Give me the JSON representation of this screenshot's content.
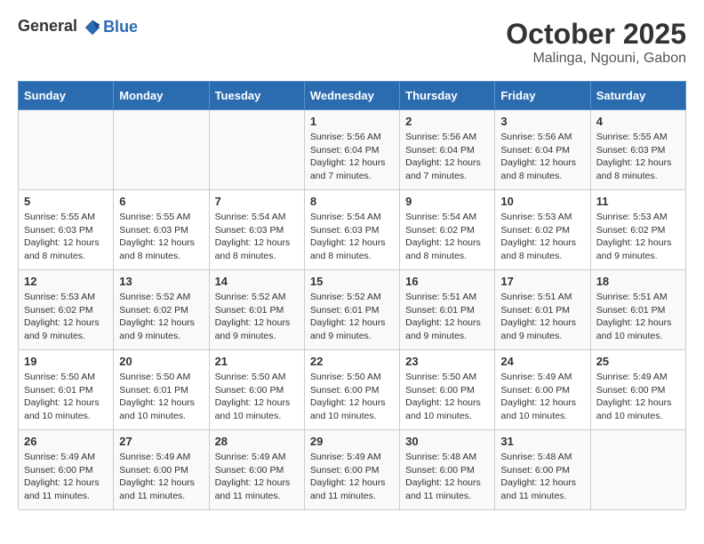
{
  "header": {
    "logo_line1": "General",
    "logo_line2": "Blue",
    "month": "October 2025",
    "location": "Malinga, Ngouni, Gabon"
  },
  "weekdays": [
    "Sunday",
    "Monday",
    "Tuesday",
    "Wednesday",
    "Thursday",
    "Friday",
    "Saturday"
  ],
  "weeks": [
    [
      {
        "day": "",
        "content": ""
      },
      {
        "day": "",
        "content": ""
      },
      {
        "day": "",
        "content": ""
      },
      {
        "day": "1",
        "content": "Sunrise: 5:56 AM\nSunset: 6:04 PM\nDaylight: 12 hours and 7 minutes."
      },
      {
        "day": "2",
        "content": "Sunrise: 5:56 AM\nSunset: 6:04 PM\nDaylight: 12 hours and 7 minutes."
      },
      {
        "day": "3",
        "content": "Sunrise: 5:56 AM\nSunset: 6:04 PM\nDaylight: 12 hours and 8 minutes."
      },
      {
        "day": "4",
        "content": "Sunrise: 5:55 AM\nSunset: 6:03 PM\nDaylight: 12 hours and 8 minutes."
      }
    ],
    [
      {
        "day": "5",
        "content": "Sunrise: 5:55 AM\nSunset: 6:03 PM\nDaylight: 12 hours and 8 minutes."
      },
      {
        "day": "6",
        "content": "Sunrise: 5:55 AM\nSunset: 6:03 PM\nDaylight: 12 hours and 8 minutes."
      },
      {
        "day": "7",
        "content": "Sunrise: 5:54 AM\nSunset: 6:03 PM\nDaylight: 12 hours and 8 minutes."
      },
      {
        "day": "8",
        "content": "Sunrise: 5:54 AM\nSunset: 6:03 PM\nDaylight: 12 hours and 8 minutes."
      },
      {
        "day": "9",
        "content": "Sunrise: 5:54 AM\nSunset: 6:02 PM\nDaylight: 12 hours and 8 minutes."
      },
      {
        "day": "10",
        "content": "Sunrise: 5:53 AM\nSunset: 6:02 PM\nDaylight: 12 hours and 8 minutes."
      },
      {
        "day": "11",
        "content": "Sunrise: 5:53 AM\nSunset: 6:02 PM\nDaylight: 12 hours and 9 minutes."
      }
    ],
    [
      {
        "day": "12",
        "content": "Sunrise: 5:53 AM\nSunset: 6:02 PM\nDaylight: 12 hours and 9 minutes."
      },
      {
        "day": "13",
        "content": "Sunrise: 5:52 AM\nSunset: 6:02 PM\nDaylight: 12 hours and 9 minutes."
      },
      {
        "day": "14",
        "content": "Sunrise: 5:52 AM\nSunset: 6:01 PM\nDaylight: 12 hours and 9 minutes."
      },
      {
        "day": "15",
        "content": "Sunrise: 5:52 AM\nSunset: 6:01 PM\nDaylight: 12 hours and 9 minutes."
      },
      {
        "day": "16",
        "content": "Sunrise: 5:51 AM\nSunset: 6:01 PM\nDaylight: 12 hours and 9 minutes."
      },
      {
        "day": "17",
        "content": "Sunrise: 5:51 AM\nSunset: 6:01 PM\nDaylight: 12 hours and 9 minutes."
      },
      {
        "day": "18",
        "content": "Sunrise: 5:51 AM\nSunset: 6:01 PM\nDaylight: 12 hours and 10 minutes."
      }
    ],
    [
      {
        "day": "19",
        "content": "Sunrise: 5:50 AM\nSunset: 6:01 PM\nDaylight: 12 hours and 10 minutes."
      },
      {
        "day": "20",
        "content": "Sunrise: 5:50 AM\nSunset: 6:01 PM\nDaylight: 12 hours and 10 minutes."
      },
      {
        "day": "21",
        "content": "Sunrise: 5:50 AM\nSunset: 6:00 PM\nDaylight: 12 hours and 10 minutes."
      },
      {
        "day": "22",
        "content": "Sunrise: 5:50 AM\nSunset: 6:00 PM\nDaylight: 12 hours and 10 minutes."
      },
      {
        "day": "23",
        "content": "Sunrise: 5:50 AM\nSunset: 6:00 PM\nDaylight: 12 hours and 10 minutes."
      },
      {
        "day": "24",
        "content": "Sunrise: 5:49 AM\nSunset: 6:00 PM\nDaylight: 12 hours and 10 minutes."
      },
      {
        "day": "25",
        "content": "Sunrise: 5:49 AM\nSunset: 6:00 PM\nDaylight: 12 hours and 10 minutes."
      }
    ],
    [
      {
        "day": "26",
        "content": "Sunrise: 5:49 AM\nSunset: 6:00 PM\nDaylight: 12 hours and 11 minutes."
      },
      {
        "day": "27",
        "content": "Sunrise: 5:49 AM\nSunset: 6:00 PM\nDaylight: 12 hours and 11 minutes."
      },
      {
        "day": "28",
        "content": "Sunrise: 5:49 AM\nSunset: 6:00 PM\nDaylight: 12 hours and 11 minutes."
      },
      {
        "day": "29",
        "content": "Sunrise: 5:49 AM\nSunset: 6:00 PM\nDaylight: 12 hours and 11 minutes."
      },
      {
        "day": "30",
        "content": "Sunrise: 5:48 AM\nSunset: 6:00 PM\nDaylight: 12 hours and 11 minutes."
      },
      {
        "day": "31",
        "content": "Sunrise: 5:48 AM\nSunset: 6:00 PM\nDaylight: 12 hours and 11 minutes."
      },
      {
        "day": "",
        "content": ""
      }
    ]
  ]
}
